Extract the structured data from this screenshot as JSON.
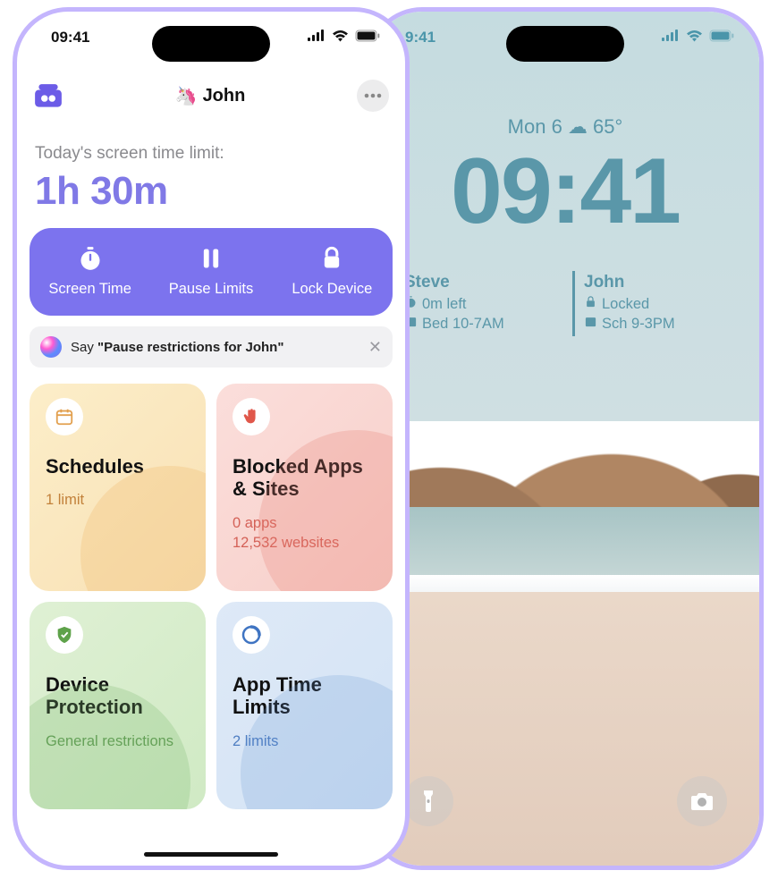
{
  "status": {
    "time": "09:41",
    "time_right": "9:41"
  },
  "header": {
    "profile_emoji": "🦄",
    "profile_name": "John"
  },
  "screen_time": {
    "label": "Today's screen time limit:",
    "value": "1h 30m"
  },
  "actions": {
    "screen_time": "Screen Time",
    "pause_limits": "Pause Limits",
    "lock_device": "Lock Device"
  },
  "siri": {
    "prefix": "Say ",
    "phrase": "\"Pause restrictions for John\""
  },
  "cards": {
    "schedules": {
      "title": "Schedules",
      "meta": "1 limit"
    },
    "blocked": {
      "title": "Blocked Apps & Sites",
      "meta_apps": "0 apps",
      "meta_sites": "12,532 websites"
    },
    "protection": {
      "title": "Device Protection",
      "meta": "General restrictions"
    },
    "timelimits": {
      "title": "App Time Limits",
      "meta": "2 limits"
    }
  },
  "lockscreen": {
    "date": "Mon 6 ☁︎ 65°",
    "time": "09:41",
    "widgets": [
      {
        "name": "Steve",
        "line1": "0m left",
        "line2": "Bed 10-7AM"
      },
      {
        "name": "John",
        "line1": "Locked",
        "line2": "Sch 9-3PM"
      }
    ]
  }
}
